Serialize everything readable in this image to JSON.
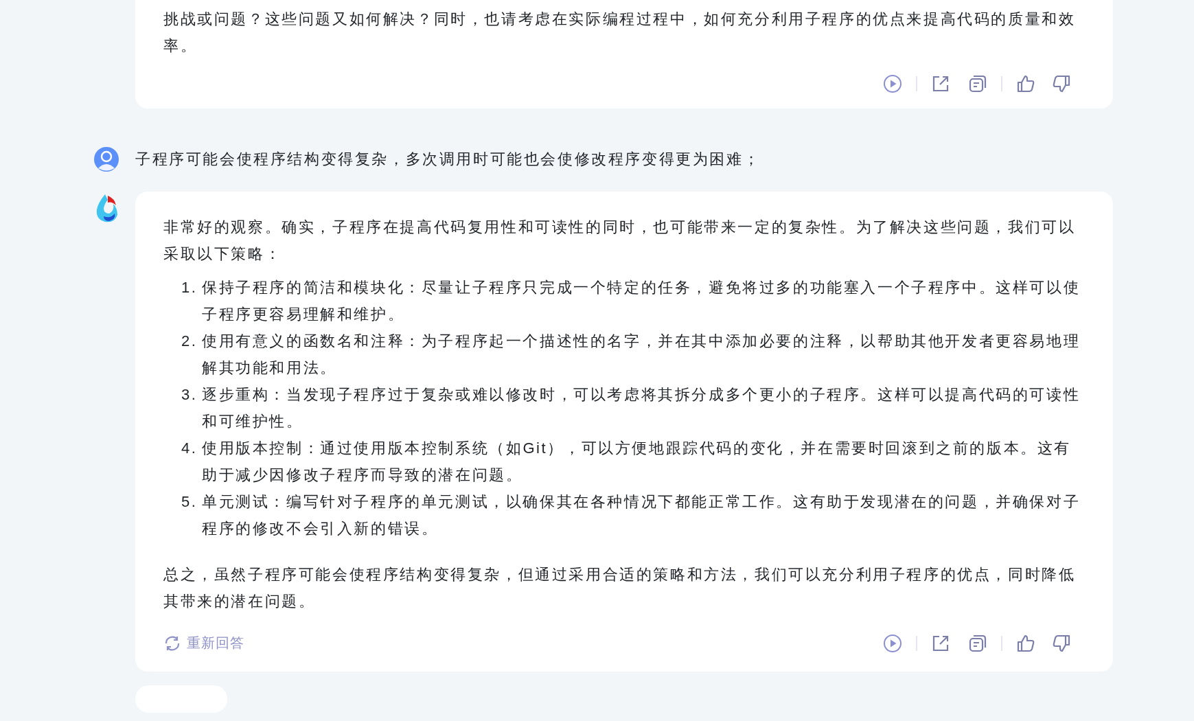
{
  "messages": [
    {
      "kind": "assistant_continued",
      "blocks": [
        {
          "kind": "paragraph",
          "text": "挑战或问题？这些问题又如何解决？同时，也请考虑在实际编程过程中，如何充分利用子程序的优点来提高代码的质量和效率。"
        }
      ]
    },
    {
      "kind": "user",
      "text": "子程序可能会使程序结构变得复杂，多次调用时可能也会使修改程序变得更为困难；"
    },
    {
      "kind": "assistant",
      "blocks": [
        {
          "kind": "paragraph",
          "text": "非常好的观察。确实，子程序在提高代码复用性和可读性的同时，也可能带来一定的复杂性。为了解决这些问题，我们可以采取以下策略："
        },
        {
          "kind": "list",
          "items": [
            {
              "number": "1.",
              "text": "保持子程序的简洁和模块化：尽量让子程序只完成一个特定的任务，避免将过多的功能塞入一个子程序中。这样可以使子程序更容易理解和维护。"
            },
            {
              "number": "2.",
              "text": "使用有意义的函数名和注释：为子程序起一个描述性的名字，并在其中添加必要的注释，以帮助其他开发者更容易地理解其功能和用法。"
            },
            {
              "number": "3.",
              "text": "逐步重构：当发现子程序过于复杂或难以修改时，可以考虑将其拆分成多个更小的子程序。这样可以提高代码的可读性和可维护性。"
            },
            {
              "number": "4.",
              "text": "使用版本控制：通过使用版本控制系统（如Git），可以方便地跟踪代码的变化，并在需要时回滚到之前的版本。这有助于减少因修改子程序而导致的潜在问题。"
            },
            {
              "number": "5.",
              "text": "单元测试：编写针对子程序的单元测试，以确保其在各种情况下都能正常工作。这有助于发现潜在的问题，并确保对子程序的修改不会引入新的错误。"
            }
          ]
        },
        {
          "kind": "paragraph",
          "text": "总之，虽然子程序可能会使程序结构变得复杂，但通过采用合适的策略和方法，我们可以充分利用子程序的优点，同时降低其带来的潜在问题。"
        }
      ],
      "regenerate": "重新回答"
    }
  ]
}
